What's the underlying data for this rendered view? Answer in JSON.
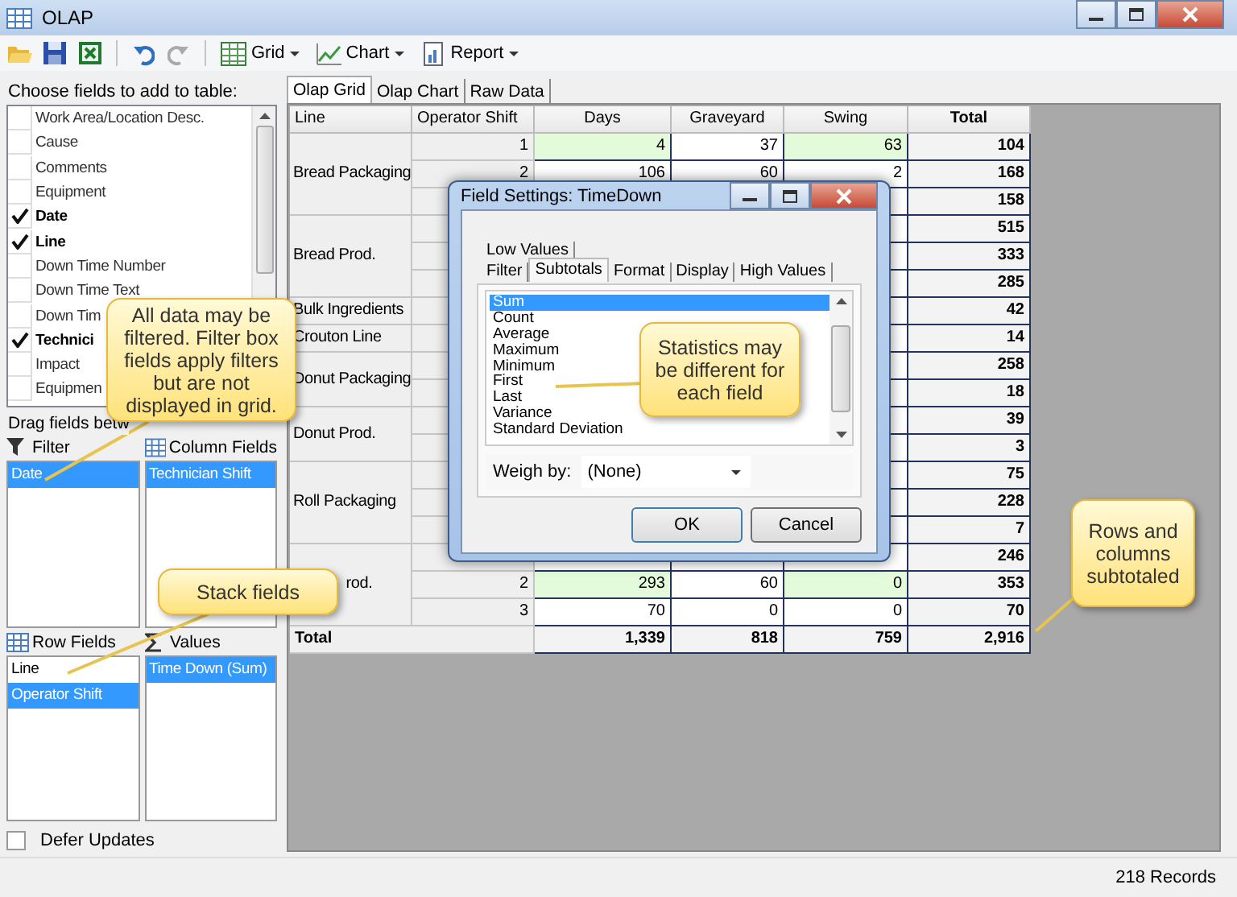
{
  "window": {
    "title": "OLAP"
  },
  "toolbar": {
    "menus": [
      {
        "label": "Grid"
      },
      {
        "label": "Chart"
      },
      {
        "label": "Report"
      }
    ]
  },
  "field_list": {
    "heading": "Choose fields to add to table:",
    "items": [
      {
        "label": "Work Area/Location Desc.",
        "checked": false
      },
      {
        "label": "Cause",
        "checked": false
      },
      {
        "label": "Comments",
        "checked": false
      },
      {
        "label": "Equipment",
        "checked": false
      },
      {
        "label": "Date",
        "checked": true
      },
      {
        "label": "Line",
        "checked": true
      },
      {
        "label": "Down Time Number",
        "checked": false
      },
      {
        "label": "Down Time Text",
        "checked": false
      },
      {
        "label": "Down Tim",
        "checked": false
      },
      {
        "label": "Technici",
        "checked": true
      },
      {
        "label": "Impact",
        "checked": false
      },
      {
        "label": "Equipmen",
        "checked": false
      }
    ]
  },
  "drag_hint": "Drag fields betw",
  "areas": [
    {
      "title": "Filter",
      "items": [
        {
          "label": "Date",
          "selected": true
        }
      ]
    },
    {
      "title": "Column Fields",
      "items": [
        {
          "label": "Technician Shift",
          "selected": true
        }
      ]
    },
    {
      "title": "Row Fields",
      "items": [
        {
          "label": "Line",
          "selected": false
        },
        {
          "label": "Operator Shift",
          "selected": true
        }
      ]
    },
    {
      "title": "Values",
      "items": [
        {
          "label": "Time Down (Sum)",
          "selected": true
        }
      ]
    }
  ],
  "defer_updates": {
    "label": "Defer Updates",
    "checked": false
  },
  "tabs": [
    {
      "label": "Olap Grid",
      "selected": true
    },
    {
      "label": "Olap Chart",
      "selected": false
    },
    {
      "label": "Raw Data",
      "selected": false
    }
  ],
  "grid": {
    "columns": [
      "Line",
      "Operator Shift",
      "Days",
      "Graveyard",
      "Swing",
      "Total"
    ],
    "groups": [
      {
        "label": "Bread Packaging",
        "kind": "full",
        "rows": [
          {
            "shift": "1",
            "days": "4",
            "graveyard": "37",
            "swing": "63",
            "total": "104",
            "shaded": true
          },
          {
            "shift": "2",
            "days": "106",
            "graveyard": "60",
            "swing": "2",
            "total": "168",
            "shaded": false
          },
          {
            "total": "158",
            "shaded": false
          }
        ]
      },
      {
        "label": "Bread Prod.",
        "kind": "full",
        "rows": [
          {
            "total": "515",
            "shaded": false
          },
          {
            "total": "333",
            "shaded": false
          },
          {
            "total": "285",
            "shaded": false
          }
        ]
      },
      {
        "label": "Bulk Ingredients",
        "kind": "full",
        "rows": [
          {
            "total": "42",
            "shaded": false
          }
        ]
      },
      {
        "label": "Crouton Line",
        "kind": "full",
        "rows": [
          {
            "total": "14",
            "shaded": false
          }
        ]
      },
      {
        "label": "Donut Packaging",
        "kind": "full",
        "rows": [
          {
            "total": "258",
            "shaded": false
          },
          {
            "total": "18",
            "shaded": false
          }
        ]
      },
      {
        "label": "Donut Prod.",
        "kind": "full",
        "rows": [
          {
            "total": "39",
            "shaded": false
          },
          {
            "total": "3",
            "shaded": false
          }
        ]
      },
      {
        "label": "Roll Packaging",
        "kind": "full",
        "rows": [
          {
            "total": "75",
            "shaded": false
          },
          {
            "total": "228",
            "shaded": false
          },
          {
            "total": "7",
            "shaded": false
          }
        ]
      },
      {
        "label": "rod.",
        "kind": "clipped",
        "rows": [
          {
            "total": "246",
            "shaded": false
          },
          {
            "shift": "2",
            "days": "293",
            "graveyard": "60",
            "swing": "0",
            "total": "353",
            "shaded": true
          },
          {
            "shift": "3",
            "days": "70",
            "graveyard": "0",
            "swing": "0",
            "total": "70",
            "shaded": false
          }
        ]
      }
    ],
    "total_row": {
      "label": "Total",
      "days": "1,339",
      "graveyard": "818",
      "swing": "759",
      "total": "2,916"
    }
  },
  "dialog": {
    "title": "Field Settings: TimeDown",
    "tab_rows": [
      [
        {
          "label": "Low Values",
          "selected": false
        }
      ],
      [
        {
          "label": "Filter",
          "selected": false
        },
        {
          "label": "Subtotals",
          "selected": true
        },
        {
          "label": "Format",
          "selected": false
        },
        {
          "label": "Display",
          "selected": false
        },
        {
          "label": "High Values",
          "selected": false
        }
      ]
    ],
    "functions": [
      {
        "label": "Sum",
        "selected": true
      },
      {
        "label": "Count",
        "selected": false
      },
      {
        "label": "Average",
        "selected": false
      },
      {
        "label": "Maximum",
        "selected": false
      },
      {
        "label": "Minimum",
        "selected": false
      },
      {
        "label": "First",
        "selected": false
      },
      {
        "label": "Last",
        "selected": false
      },
      {
        "label": "Variance",
        "selected": false
      },
      {
        "label": "Standard Deviation",
        "selected": false
      }
    ],
    "weigh_by": {
      "label": "Weigh by:",
      "value": "(None)"
    },
    "buttons": [
      "OK",
      "Cancel"
    ]
  },
  "callouts": [
    {
      "text": "All data may be filtered. Filter box fields apply filters but are not displayed in grid."
    },
    {
      "text": "Stack fields"
    },
    {
      "text": "Statistics may be different for each field"
    },
    {
      "text": "Rows and columns subtotaled"
    }
  ],
  "status_bar": {
    "records": "218 Records"
  }
}
